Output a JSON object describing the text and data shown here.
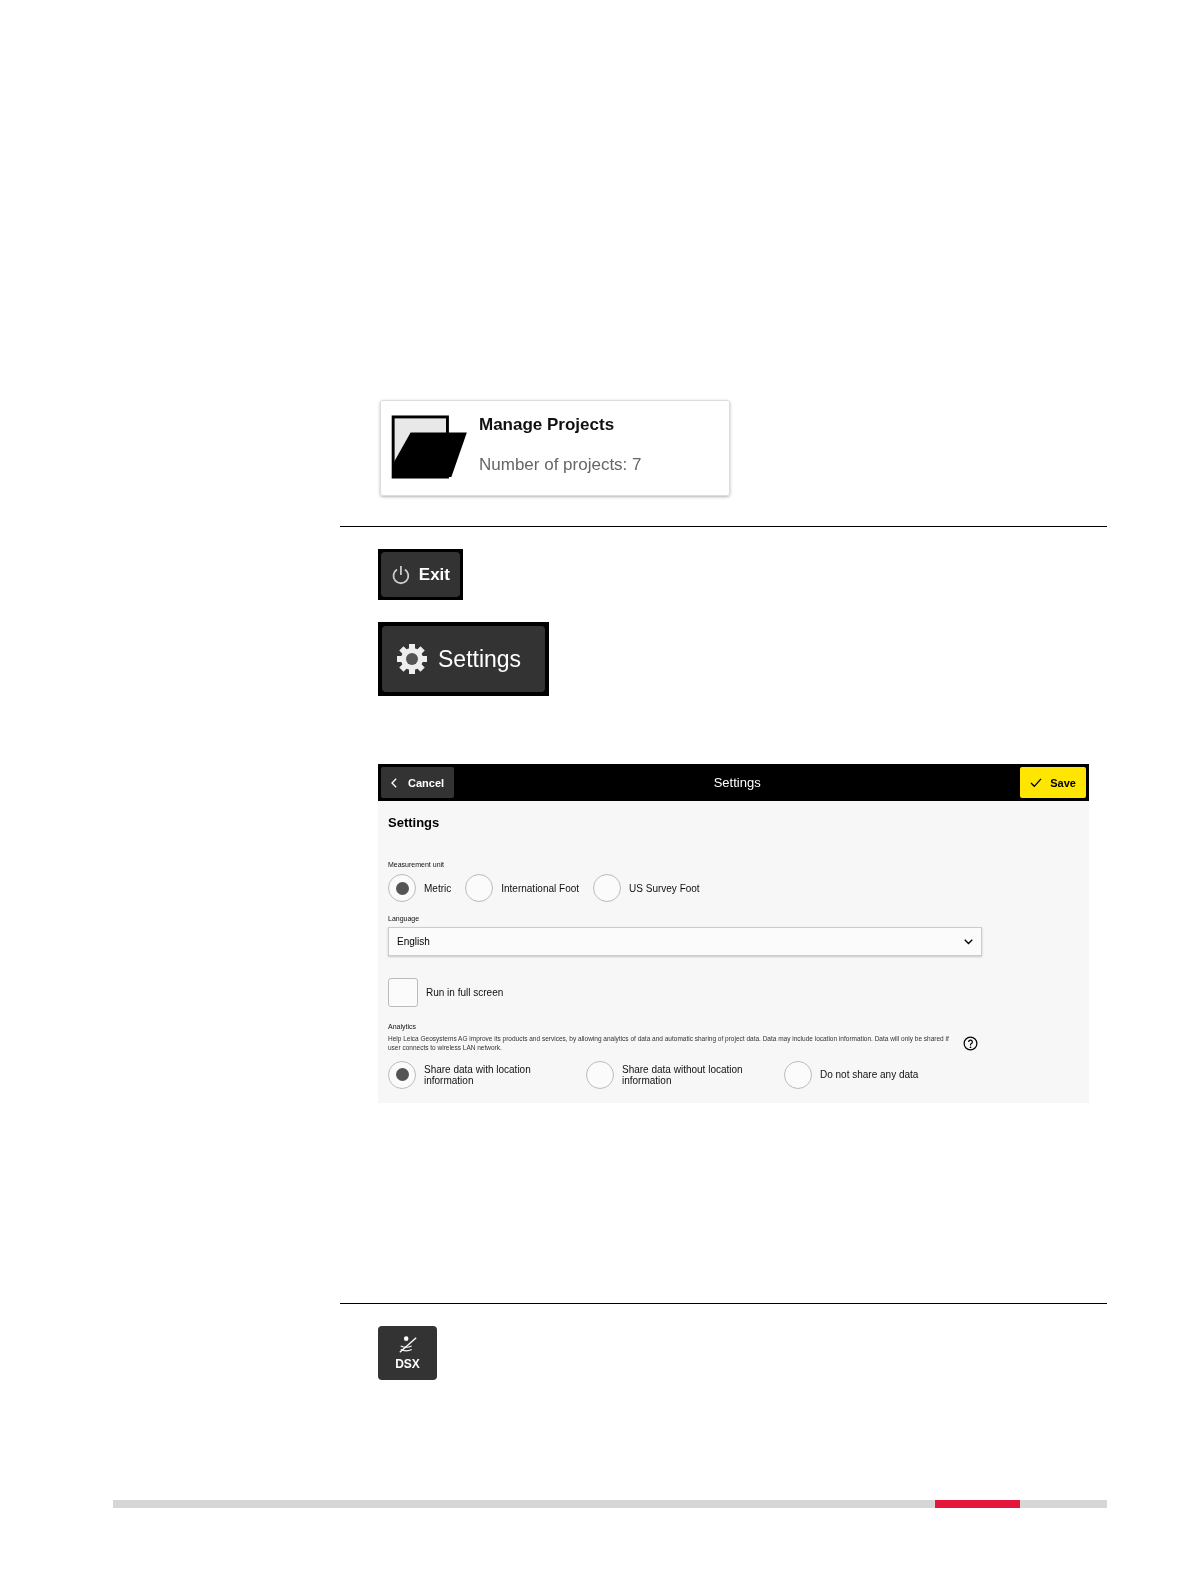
{
  "manage_projects": {
    "title": "Manage Projects",
    "subtitle": "Number of projects: 7"
  },
  "exit_button": {
    "label": "Exit"
  },
  "settings_button": {
    "label": "Settings"
  },
  "settings_screen": {
    "header": {
      "cancel": "Cancel",
      "title": "Settings",
      "save": "Save"
    },
    "heading": "Settings",
    "measurement_unit": {
      "label": "Measurement unit",
      "options": [
        {
          "label": "Metric",
          "selected": true
        },
        {
          "label": "International Foot",
          "selected": false
        },
        {
          "label": "US Survey Foot",
          "selected": false
        }
      ]
    },
    "language": {
      "label": "Language",
      "value": "English"
    },
    "full_screen": {
      "label": "Run in full screen",
      "checked": false
    },
    "analytics": {
      "label": "Analytics",
      "description": "Help Leica Geosystems AG improve its products and services, by allowing analytics of data and automatic sharing of project data. Data may include location information. Data will only be shared if user connects to wireless LAN network.",
      "options": [
        {
          "label": "Share data with location information",
          "selected": true
        },
        {
          "label": "Share data without location information",
          "selected": false
        },
        {
          "label": "Do not share any data",
          "selected": false
        }
      ]
    }
  },
  "dsx_button": {
    "label": "DSX"
  }
}
